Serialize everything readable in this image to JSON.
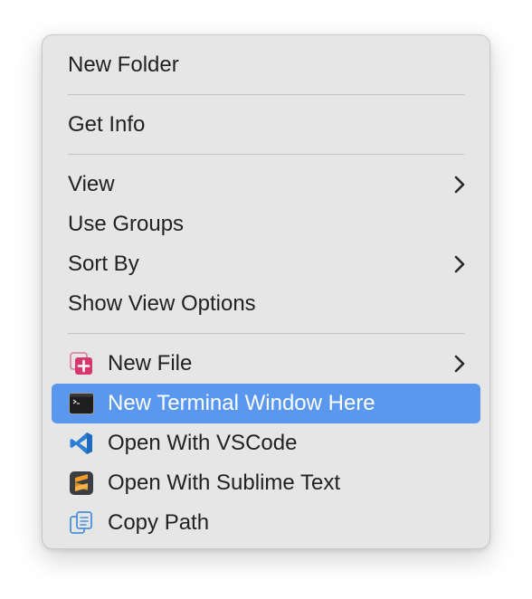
{
  "menu": {
    "groups": [
      {
        "items": [
          {
            "label": "New Folder"
          }
        ]
      },
      {
        "items": [
          {
            "label": "Get Info"
          }
        ]
      },
      {
        "items": [
          {
            "label": "View",
            "submenu": true
          },
          {
            "label": "Use Groups"
          },
          {
            "label": "Sort By",
            "submenu": true
          },
          {
            "label": "Show View Options"
          }
        ]
      },
      {
        "items": [
          {
            "label": "New File",
            "submenu": true,
            "icon": "new-file-icon"
          },
          {
            "label": "New Terminal Window Here",
            "icon": "terminal-icon",
            "selected": true
          },
          {
            "label": "Open With VSCode",
            "icon": "vscode-icon"
          },
          {
            "label": "Open With Sublime Text",
            "icon": "sublime-text-icon"
          },
          {
            "label": "Copy Path",
            "icon": "copy-path-icon"
          }
        ]
      }
    ]
  },
  "colors": {
    "menu_background": "#e6e6e6",
    "selection": "#5a97ee",
    "text": "#222222",
    "new_file_icon": "#d6376f",
    "vscode_icon": "#2a7fd4",
    "sublime_icon": "#f29b26",
    "copy_path_icon": "#4a8fd8"
  }
}
